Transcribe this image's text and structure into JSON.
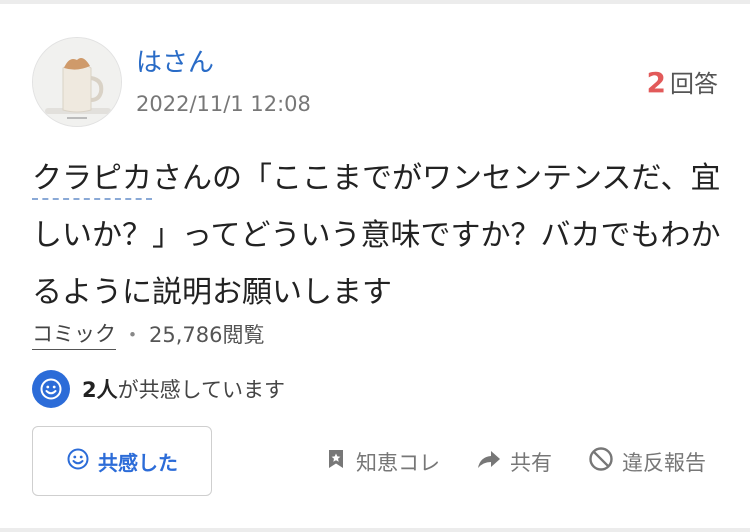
{
  "user": {
    "name": "はさん",
    "posted_at": "2022/11/1 12:08"
  },
  "answers": {
    "count": "2",
    "label": "回答"
  },
  "question": {
    "linked_term": "クラピカ",
    "text_after_link": "さんの「ここまでがワンセンテンスだ、宜しいか？」ってどういう意味ですか？バカでもわかるように説明お願いします"
  },
  "meta": {
    "category": "コミック",
    "separator": "・",
    "views": "25,786閲覧"
  },
  "empathy": {
    "count": "2人",
    "suffix": "が共感しています",
    "button_label": "共感した"
  },
  "actions": {
    "bookmark_label": "知恵コレ",
    "share_label": "共有",
    "report_label": "違反報告"
  },
  "colors": {
    "link": "#2a6cc7",
    "accent": "#2c6cd8",
    "answer_count": "#e25a5a"
  },
  "icons": [
    "smile-icon",
    "bookmark-icon",
    "share-icon",
    "report-icon"
  ]
}
